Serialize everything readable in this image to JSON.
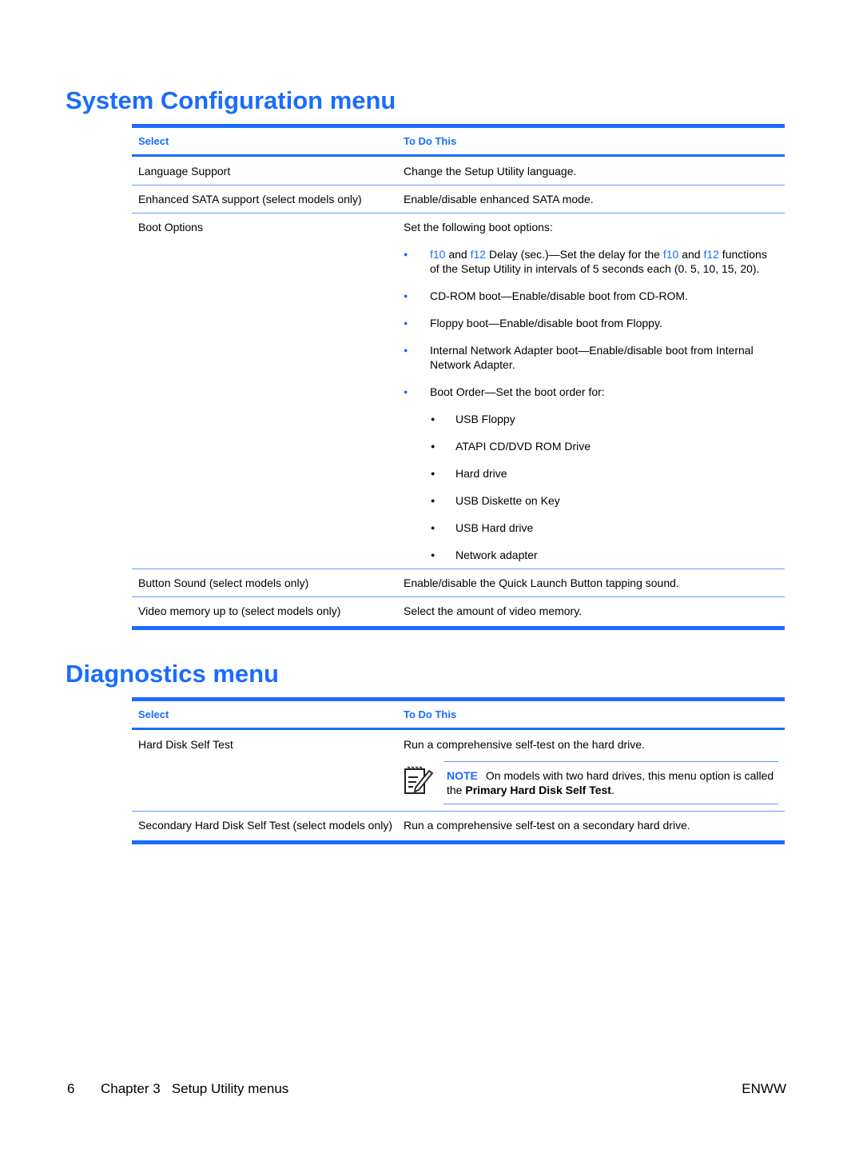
{
  "sections": [
    {
      "title": "System Configuration menu",
      "header": {
        "col1": "Select",
        "col2": "To Do This"
      },
      "rows": [
        {
          "select": "Language Support",
          "action": "Change the Setup Utility language."
        },
        {
          "select": "Enhanced SATA support (select models only)",
          "action": "Enable/disable enhanced SATA mode."
        },
        {
          "select": "Boot Options",
          "action": "Set the following boot options:"
        },
        {
          "select": "Button Sound (select models only)",
          "action": "Enable/disable the Quick Launch Button tapping sound."
        },
        {
          "select": "Video memory up to (select models only)",
          "action": "Select the amount of video memory."
        }
      ],
      "boot_options": {
        "delay": {
          "key1": "f10",
          "and": " and ",
          "key2": "f12",
          "text1": " Delay (sec.)—Set the delay for the ",
          "key3": "f10",
          "and2": " and ",
          "key4": "f12",
          "text2": " functions of the Setup Utility in intervals of 5 seconds each (0. 5, 10, 15, 20)."
        },
        "items": [
          "CD-ROM boot—Enable/disable boot from CD-ROM.",
          "Floppy boot—Enable/disable boot from Floppy.",
          "Internal Network Adapter boot—Enable/disable boot from Internal Network Adapter.",
          "Boot Order—Set the boot order for:"
        ],
        "boot_order": [
          "USB Floppy",
          "ATAPI CD/DVD ROM Drive",
          "Hard drive",
          "USB Diskette on Key",
          "USB Hard drive",
          "Network adapter"
        ]
      }
    },
    {
      "title": "Diagnostics menu",
      "header": {
        "col1": "Select",
        "col2": "To Do This"
      },
      "rows": [
        {
          "select": "Hard Disk Self Test",
          "action": "Run a comprehensive self-test on the hard drive."
        },
        {
          "select": "Secondary Hard Disk Self Test (select models only)",
          "action": "Run a comprehensive self-test on a secondary hard drive."
        }
      ],
      "note": {
        "icon": "note-pencil-icon",
        "label": "NOTE",
        "text": "On models with two hard drives, this menu option is called the ",
        "bold": "Primary Hard Disk Self Test",
        "end": "."
      }
    }
  ],
  "footer": {
    "page": "6",
    "chapter": "Chapter 3   Setup Utility menus",
    "locale": "ENWW"
  },
  "colors": {
    "accent": "#1a6cff"
  }
}
